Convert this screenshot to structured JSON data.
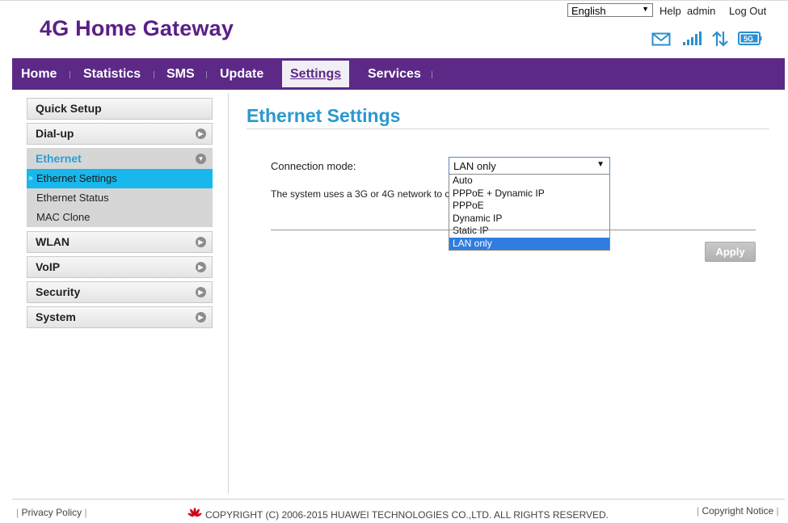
{
  "header": {
    "brand": "4G Home Gateway",
    "language_selected": "English",
    "help_label": "Help",
    "user_label": "admin",
    "logout_label": "Log Out",
    "status_icons": [
      "mail-icon",
      "signal-strength-icon",
      "data-transfer-icon",
      "network-5g-icon"
    ],
    "network_badge": "5G"
  },
  "nav": {
    "items": [
      {
        "label": "Home"
      },
      {
        "label": "Statistics"
      },
      {
        "label": "SMS"
      },
      {
        "label": "Update"
      },
      {
        "label": "Settings"
      },
      {
        "label": "Services"
      }
    ],
    "active": "Settings"
  },
  "sidebar": {
    "items": [
      {
        "label": "Quick Setup"
      },
      {
        "label": "Dial-up"
      },
      {
        "label": "Ethernet"
      },
      {
        "label": "WLAN"
      },
      {
        "label": "VoIP"
      },
      {
        "label": "Security"
      },
      {
        "label": "System"
      }
    ],
    "ethernet_sub": [
      {
        "label": "Ethernet Settings"
      },
      {
        "label": "Ethernet Status"
      },
      {
        "label": "MAC Clone"
      }
    ],
    "selected_sub": "Ethernet Settings"
  },
  "main": {
    "title": "Ethernet Settings",
    "connection_mode_label": "Connection mode:",
    "connection_mode_value": "LAN only",
    "description": "The system uses a 3G or 4G network to c",
    "options": [
      "Auto",
      "PPPoE + Dynamic IP",
      "PPPoE",
      "Dynamic IP",
      "Static IP",
      "LAN only"
    ],
    "selected_option": "LAN only",
    "apply_label": "Apply"
  },
  "footer": {
    "privacy_label": "Privacy Policy",
    "copyright": "COPYRIGHT (C) 2006-2015 HUAWEI TECHNOLOGIES CO.,LTD. ALL RIGHTS RESERVED.",
    "copyright_notice_label": "Copyright Notice"
  },
  "colors": {
    "brand": "#5b1f86",
    "nav_bg": "#5c2a86",
    "accent": "#2a98cf",
    "selected_sub_bg": "#18b8ec",
    "icon_blue": "#2a8fd0",
    "huawei_red": "#d0021b"
  }
}
